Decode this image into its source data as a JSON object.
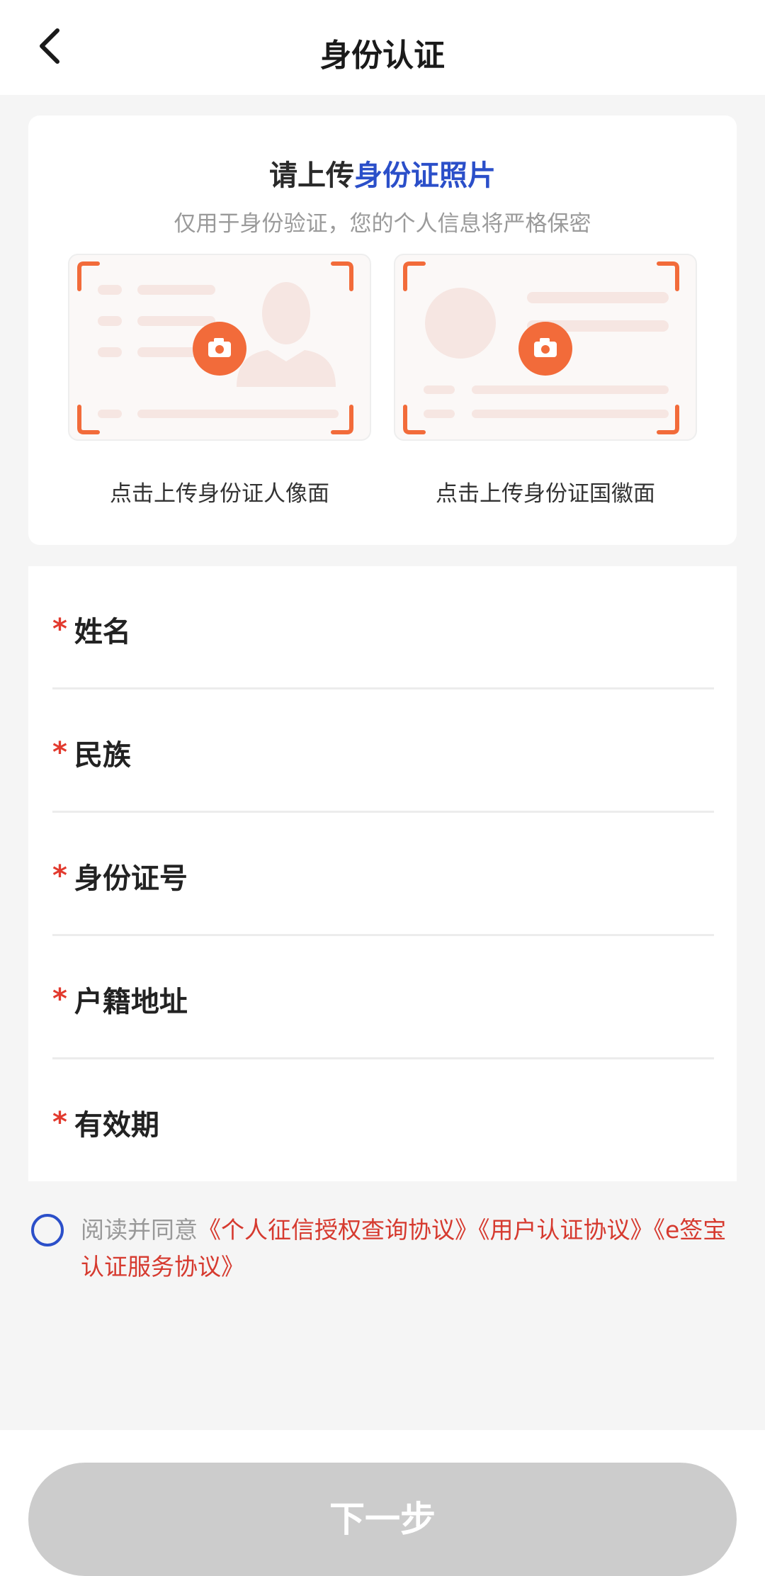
{
  "header": {
    "title": "身份认证",
    "back_icon": "chevron-left-icon"
  },
  "upload": {
    "title_prefix": "请上传",
    "title_highlight": "身份证照片",
    "subtitle": "仅用于身份验证，您的个人信息将严格保密",
    "front_label": "点击上传身份证人像面",
    "back_label": "点击上传身份证国徽面",
    "accent_color": "#f26b3a",
    "highlight_color": "#2b4fc9"
  },
  "form": {
    "required_mark": "*",
    "fields": [
      {
        "label": "姓名",
        "value": ""
      },
      {
        "label": "民族",
        "value": ""
      },
      {
        "label": "身份证号",
        "value": ""
      },
      {
        "label": "户籍地址",
        "value": ""
      },
      {
        "label": "有效期",
        "value": ""
      }
    ]
  },
  "agreement": {
    "prefix": "阅读并同意",
    "links": [
      "《个人征信授权查询协议》",
      "《用户认证协议》",
      "《e签宝认证服务协议》"
    ],
    "checked": false
  },
  "footer": {
    "next_label": "下一步"
  }
}
